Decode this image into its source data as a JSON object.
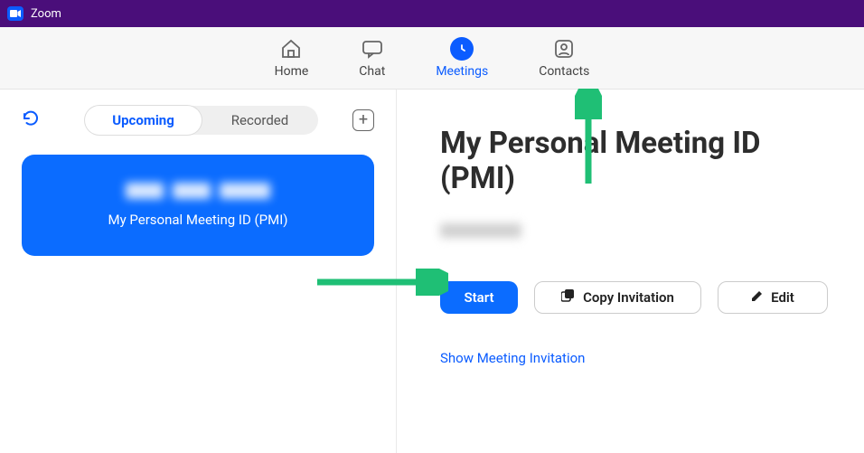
{
  "titlebar": {
    "app_name": "Zoom"
  },
  "topnav": {
    "home": "Home",
    "chat": "Chat",
    "meetings": "Meetings",
    "contacts": "Contacts",
    "active": "meetings"
  },
  "sidebar": {
    "tabs": {
      "upcoming": "Upcoming",
      "recorded": "Recorded",
      "selected": "upcoming"
    },
    "meeting_card": {
      "label": "My Personal Meeting ID (PMI)"
    }
  },
  "detail": {
    "title": "My Personal Meeting ID (PMI)",
    "buttons": {
      "start": "Start",
      "copy": "Copy Invitation",
      "edit": "Edit"
    },
    "show_invitation": "Show Meeting Invitation"
  },
  "colors": {
    "accent": "#0b5cff",
    "primary_btn": "#0b6cff",
    "titlebar_bg": "#4a0e7a",
    "arrow": "#1fbf75"
  }
}
